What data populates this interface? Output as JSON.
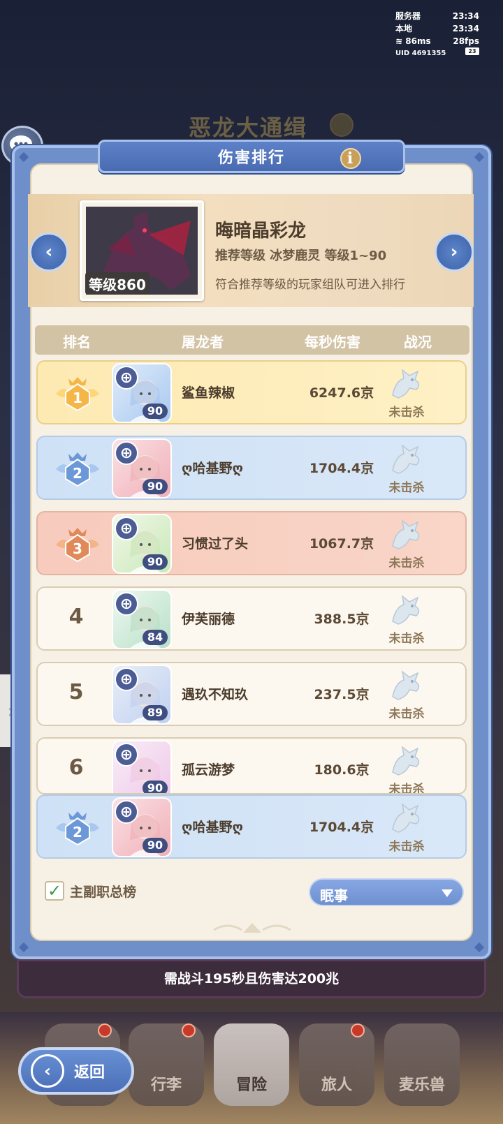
{
  "status_bar": {
    "server_label": "服务器",
    "server_time": "23:34",
    "local_label": "本地",
    "local_time": "23:34",
    "ping": "86ms",
    "fps": "28fps",
    "uid": "UID 4691355",
    "battery": "23"
  },
  "background_title": "恶龙大通缉",
  "panel": {
    "title": "伤害排行"
  },
  "boss": {
    "name": "晦暗晶彩龙",
    "level": "等级860",
    "recommend": "推荐等级 冰梦鹿灵 等级1~90",
    "note": "符合推荐等级的玩家组队可进入排行"
  },
  "table": {
    "headers": [
      "排名",
      "屠龙者",
      "每秒伤害",
      "战况"
    ],
    "rows": [
      {
        "rank": "1",
        "name": "鲨鱼辣椒",
        "level": "90",
        "damage": "6247.6京",
        "status": "未击杀",
        "tier": "gold"
      },
      {
        "rank": "2",
        "name": "ღ哈基野ღ",
        "level": "90",
        "damage": "1704.4京",
        "status": "未击杀",
        "tier": "silver"
      },
      {
        "rank": "3",
        "name": "习惯过了头",
        "level": "90",
        "damage": "1067.7京",
        "status": "未击杀",
        "tier": "bronze"
      },
      {
        "rank": "4",
        "name": "伊芙丽德",
        "level": "84",
        "damage": "388.5京",
        "status": "未击杀",
        "tier": "plain"
      },
      {
        "rank": "5",
        "name": "遇玖不知玖",
        "level": "89",
        "damage": "237.5京",
        "status": "未击杀",
        "tier": "plain"
      },
      {
        "rank": "6",
        "name": "孤云游梦",
        "level": "90",
        "damage": "180.6京",
        "status": "未击杀",
        "tier": "plain"
      }
    ],
    "self_row": {
      "rank": "2",
      "name": "ღ哈基野ღ",
      "level": "90",
      "damage": "1704.4京",
      "status": "未击杀",
      "tier": "silver"
    }
  },
  "filters": {
    "checkbox_label": "主副职总榜",
    "checked": true,
    "server_select": "眠事"
  },
  "requirement": "需战斗195秒且伤害达200兆",
  "nav": {
    "back": "返回",
    "items": [
      "行李",
      "冒险",
      "旅人",
      "麦乐兽"
    ],
    "active": "冒险"
  },
  "colors": {
    "accent": "#5e86cb",
    "gold": "#fde9b2",
    "silver": "#cfe1f6",
    "bronze": "#f7cbbd"
  }
}
